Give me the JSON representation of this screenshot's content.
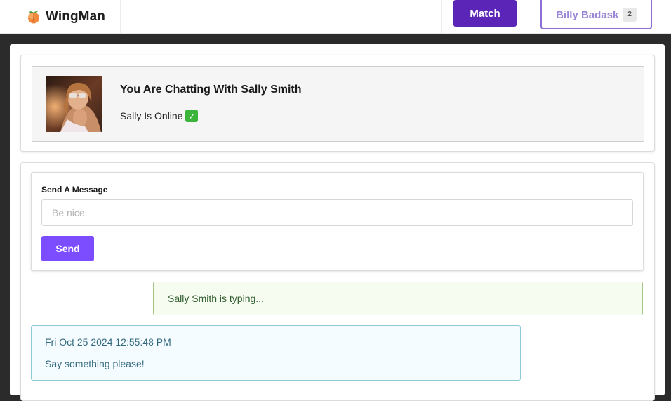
{
  "navbar": {
    "brand_name": "WingMan",
    "brand_icon": "peach-icon",
    "match_label": "Match",
    "user_name": "Billy Badask",
    "user_badge": "2"
  },
  "profile": {
    "chat_title": "You Are Chatting With Sally Smith",
    "status_text": "Sally Is Online",
    "status_icon": "check-mark-icon"
  },
  "message_form": {
    "label": "Send A Message",
    "placeholder": "Be nice.",
    "value": "",
    "send_label": "Send"
  },
  "typing_notice": "Sally Smith is typing...",
  "messages": [
    {
      "timestamp": "Fri Oct 25 2024 12:55:48 PM",
      "text": "Say something please!"
    }
  ],
  "colors": {
    "match_button": "#5b25b8",
    "send_button": "#7c4dff",
    "user_button_border": "#8b6fd4",
    "typing_border": "#a6c48a",
    "message_border": "#8fc8d8"
  }
}
